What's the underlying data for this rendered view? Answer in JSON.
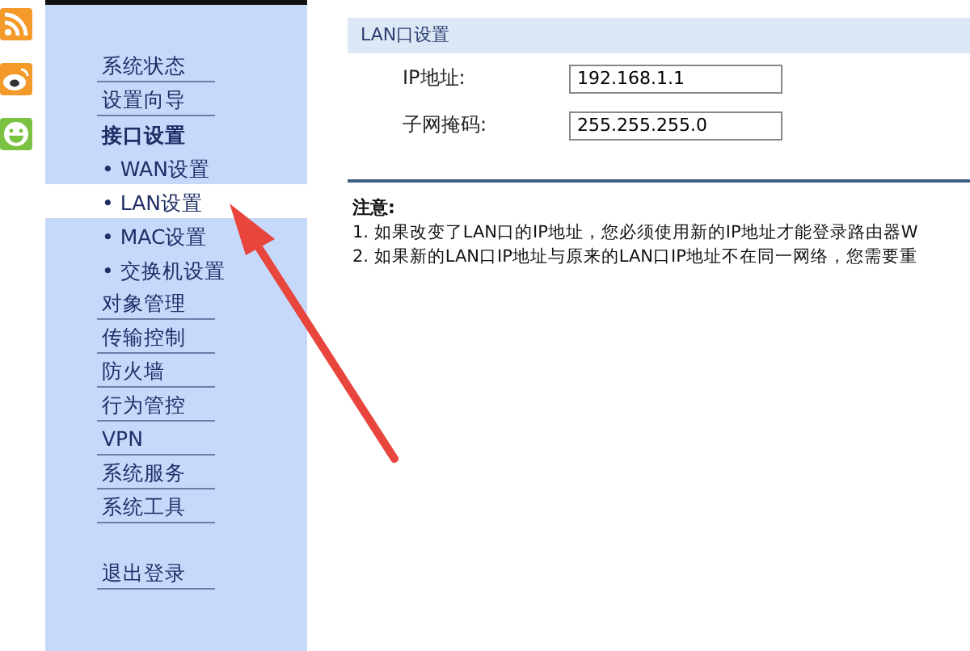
{
  "side_icons": [
    {
      "kind": "rss",
      "color": "#f39a2b"
    },
    {
      "kind": "weibo",
      "color": "#f39a2b"
    },
    {
      "kind": "smile",
      "color": "#7cc242"
    }
  ],
  "sidebar": {
    "items": [
      {
        "label": "系统状态",
        "kind": "item",
        "selected": false
      },
      {
        "label": "设置向导",
        "kind": "item",
        "selected": false
      },
      {
        "label": "接口设置",
        "kind": "header",
        "selected": false
      },
      {
        "label": "• WAN设置",
        "kind": "sub",
        "selected": false
      },
      {
        "label": "• LAN设置",
        "kind": "sub",
        "selected": true
      },
      {
        "label": "• MAC设置",
        "kind": "sub",
        "selected": false
      },
      {
        "label": "• 交换机设置",
        "kind": "sub",
        "selected": false
      },
      {
        "label": "对象管理",
        "kind": "item",
        "selected": false
      },
      {
        "label": "传输控制",
        "kind": "item",
        "selected": false
      },
      {
        "label": "防火墙",
        "kind": "item",
        "selected": false
      },
      {
        "label": "行为管控",
        "kind": "item",
        "selected": false
      },
      {
        "label": "VPN",
        "kind": "item",
        "selected": false
      },
      {
        "label": "系统服务",
        "kind": "item",
        "selected": false
      },
      {
        "label": "系统工具",
        "kind": "item",
        "selected": false
      },
      {
        "label": "退出登录",
        "kind": "spaced",
        "selected": false
      }
    ]
  },
  "panel": {
    "title": "LAN口设置",
    "fields": [
      {
        "label": "IP地址:",
        "value": "192.168.1.1"
      },
      {
        "label": "子网掩码:",
        "value": "255.255.255.0"
      }
    ]
  },
  "notes": {
    "title": "注意:",
    "lines": [
      "1. 如果改变了LAN口的IP地址，您必须使用新的IP地址才能登录路由器W",
      "2. 如果新的LAN口IP地址与原来的LAN口IP地址不在同一网络，您需要重"
    ]
  }
}
